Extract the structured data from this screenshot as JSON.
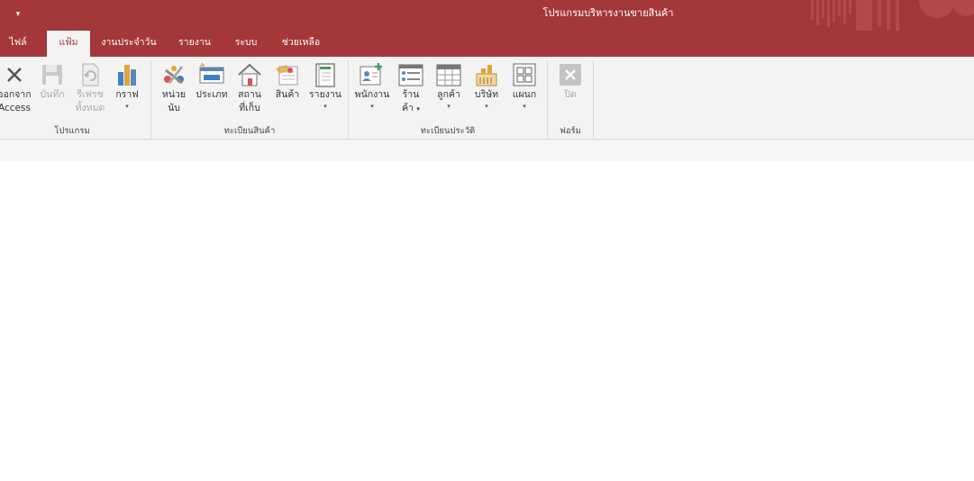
{
  "window": {
    "title": "โปรแกรมบริหารงานขายสินค้า",
    "qat_symbol": "▾",
    "accent_color": "#a4373a"
  },
  "tabs": [
    {
      "label": "ไฟล์",
      "active": false
    },
    {
      "label": "แฟ้ม",
      "active": true
    },
    {
      "label": "งานประจำวัน",
      "active": false
    },
    {
      "label": "รายงาน",
      "active": false
    },
    {
      "label": "ระบบ",
      "active": false
    },
    {
      "label": "ช่วยเหลือ",
      "active": false
    }
  ],
  "ribbon": {
    "groups": {
      "program": {
        "label": "โปรแกรม",
        "exit": {
          "line1": "ออกจาก",
          "line2": "Access",
          "icon": "close-x-icon"
        },
        "save": {
          "label": "บันทึก",
          "icon": "floppy-disk-icon",
          "disabled": true
        },
        "refresh": {
          "line1": "รีเฟรช",
          "line2": "ทั้งหมด",
          "icon": "refresh-document-icon",
          "disabled": true
        },
        "chart": {
          "label": "กราฟ",
          "caret": "▾",
          "icon": "bar-chart-icon"
        }
      },
      "product_registry": {
        "label": "ทะเบียนสินค้า",
        "unit": {
          "line1": "หน่วย",
          "line2": "นับ",
          "icon": "unit-tools-icon"
        },
        "category": {
          "label": "ประเภท",
          "icon": "category-window-icon"
        },
        "location": {
          "line1": "สถาน",
          "line2": "ที่เก็บ",
          "icon": "house-icon"
        },
        "product": {
          "label": "สินค้า",
          "icon": "product-cart-icon"
        },
        "report": {
          "label": "รายงาน",
          "caret": "▾",
          "icon": "report-notebook-icon"
        }
      },
      "history_registry": {
        "label": "ทะเบียนประวัติ",
        "employee": {
          "label": "พนักงาน",
          "caret": "▾",
          "icon": "employee-card-icon"
        },
        "shop": {
          "line1": "ร้าน",
          "line2": "ค้า",
          "caret": "▾",
          "icon": "shop-list-icon"
        },
        "customer": {
          "label": "ลูกค้า",
          "caret": "▾",
          "icon": "customer-table-icon"
        },
        "company": {
          "label": "บริษัท",
          "caret": "▾",
          "icon": "company-building-icon"
        },
        "department": {
          "label": "แผนก",
          "caret": "▾",
          "icon": "department-grid-icon"
        }
      },
      "form": {
        "label": "ฟอร์ม",
        "close": {
          "label": "ปิด",
          "icon": "close-form-icon",
          "disabled": true
        }
      }
    }
  }
}
